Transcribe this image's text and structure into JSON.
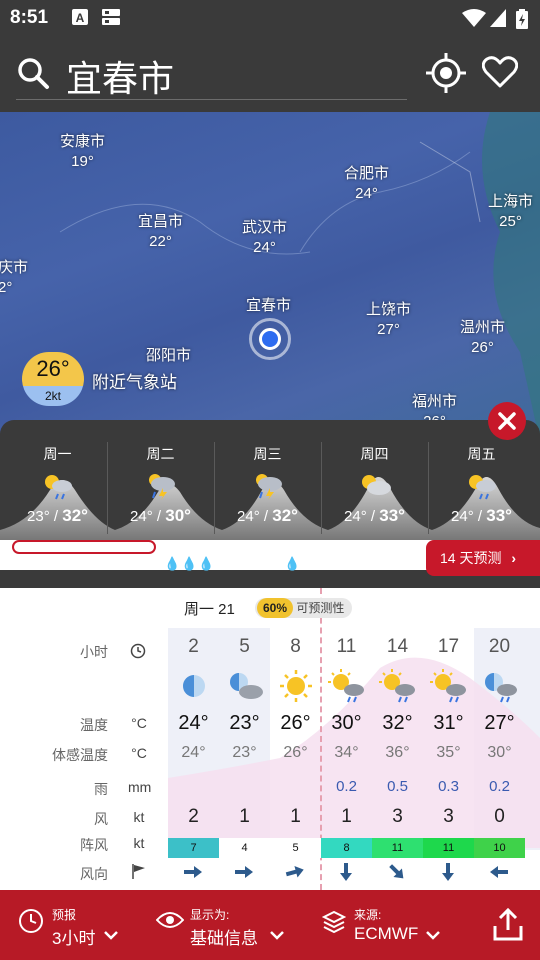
{
  "status_bar": {
    "time": "8:51"
  },
  "search": {
    "city": "宜春市"
  },
  "map": {
    "labels": [
      {
        "name": "安康市",
        "temp": "19°"
      },
      {
        "name": "合肥市",
        "temp": "24°"
      },
      {
        "name": "上海市",
        "temp": "25°"
      },
      {
        "name": "宜昌市",
        "temp": "22°"
      },
      {
        "name": "武汉市",
        "temp": "24°"
      },
      {
        "name": "庆市",
        "temp": "2°"
      },
      {
        "name": "宜春市",
        "temp": ""
      },
      {
        "name": "上饶市",
        "temp": "27°"
      },
      {
        "name": "温州市",
        "temp": "26°"
      },
      {
        "name": "邵阳市",
        "temp": ""
      },
      {
        "name": "福州市",
        "temp": "26°"
      }
    ],
    "station": {
      "temp": "26°",
      "wind": "2kt",
      "label": "附近气象站"
    }
  },
  "daily": [
    {
      "day": "周一",
      "low": "23°",
      "high": "32°",
      "icon": "sun-rain-icon"
    },
    {
      "day": "周二",
      "low": "24°",
      "high": "30°",
      "icon": "thunder-rain-icon"
    },
    {
      "day": "周三",
      "low": "24°",
      "high": "32°",
      "icon": "thunder-rain-icon"
    },
    {
      "day": "周四",
      "low": "24°",
      "high": "33°",
      "icon": "partly-cloudy-icon"
    },
    {
      "day": "周五",
      "low": "24°",
      "high": "33°",
      "icon": "sun-rain-icon"
    }
  ],
  "forecast14": {
    "label": "14 天预测"
  },
  "table": {
    "day_header": "周一 21",
    "predictability": {
      "pct": "60%",
      "label": "可预测性"
    },
    "labels": {
      "hour": "小时",
      "temp": "温度",
      "feel": "体感温度",
      "rain": "雨",
      "wind": "风",
      "gust": "阵风",
      "dir": "风向"
    },
    "units": {
      "temp": "°C",
      "feel": "°C",
      "rain": "mm",
      "wind": "kt",
      "gust": "kt"
    },
    "hours": [
      "2",
      "5",
      "8",
      "11",
      "14",
      "17",
      "20"
    ],
    "temps": [
      "24°",
      "23°",
      "26°",
      "30°",
      "32°",
      "31°",
      "27°"
    ],
    "feels": [
      "24°",
      "23°",
      "26°",
      "34°",
      "36°",
      "35°",
      "30°"
    ],
    "rain": [
      "",
      "",
      "",
      "0.2",
      "0.5",
      "0.3",
      "0.2"
    ],
    "wind": [
      "2",
      "1",
      "1",
      "1",
      "3",
      "3",
      "0"
    ],
    "gust": [
      "7",
      "4",
      "5",
      "8",
      "11",
      "11",
      "10"
    ],
    "gust_colors": [
      "#3cc0c8",
      "#ffffff",
      "#ffffff",
      "#33d9c0",
      "#2ee070",
      "#1ed84c",
      "#3fd24a"
    ],
    "icons": [
      "moon-icon",
      "moon-cloud-icon",
      "sun-icon",
      "sun-rain-icon",
      "sun-rain-icon",
      "sun-rain-icon",
      "moon-rain-icon"
    ],
    "wind_dirs": [
      "east",
      "east",
      "east-northeast",
      "south",
      "southeast",
      "south",
      "west"
    ]
  },
  "bottom_bar": {
    "forecast": {
      "small": "预报",
      "big": "3小时"
    },
    "display": {
      "small": "显示为:",
      "big": "基础信息"
    },
    "source": {
      "small": "来源:",
      "big": "ECMWF"
    }
  }
}
